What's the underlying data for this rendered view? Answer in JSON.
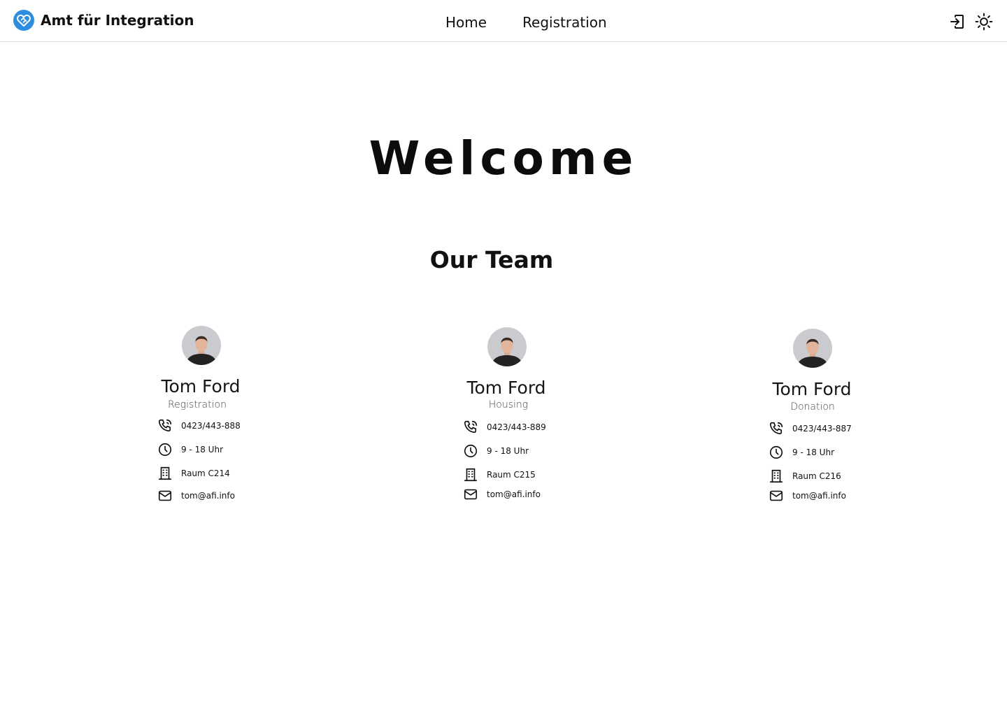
{
  "header": {
    "brand_name": "Amt für Integration",
    "brand_icon": "heart-handshake-icon",
    "brand_color": "#2d8ee0",
    "nav": [
      {
        "label": "Home"
      },
      {
        "label": "Registration"
      }
    ],
    "actions": [
      {
        "icon": "login-icon"
      },
      {
        "icon": "sun-icon"
      }
    ]
  },
  "hero": {
    "title": "Welcome"
  },
  "team": {
    "title": "Our Team",
    "members": [
      {
        "name": "Tom Ford",
        "role": "Registration",
        "phone": "0423/443-888",
        "hours": "9 - 18 Uhr",
        "room": "Raum C214",
        "email": "tom@afi.info"
      },
      {
        "name": "Tom Ford",
        "role": "Housing",
        "phone": "0423/443-889",
        "hours": "9 - 18 Uhr",
        "room": "Raum C215",
        "email": "tom@afi.info"
      },
      {
        "name": "Tom Ford",
        "role": "Donation",
        "phone": "0423/443-887",
        "hours": "9 - 18 Uhr",
        "room": "Raum C216",
        "email": "tom@afi.info"
      }
    ]
  }
}
